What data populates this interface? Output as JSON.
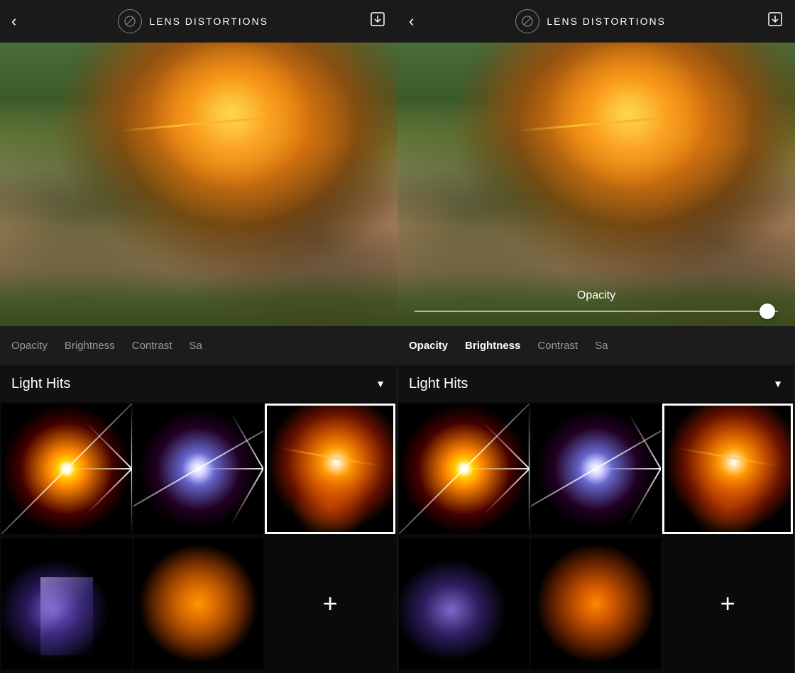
{
  "panels": [
    {
      "id": "left",
      "header": {
        "back_label": "‹",
        "logo_icon": "lens-logo",
        "title": "LENS DISTORTIONS",
        "download_icon": "download"
      },
      "controls": [
        {
          "label": "Opacity",
          "active": false
        },
        {
          "label": "Brightness",
          "active": false
        },
        {
          "label": "Contrast",
          "active": false
        },
        {
          "label": "Sa",
          "active": false
        }
      ],
      "opacity_slider_visible": false,
      "light_hits": {
        "title": "Light Hits",
        "dropdown_icon": "▼"
      }
    },
    {
      "id": "right",
      "header": {
        "back_label": "‹",
        "logo_icon": "lens-logo",
        "title": "LENS DISTORTIONS",
        "download_icon": "download"
      },
      "controls": [
        {
          "label": "Opacity",
          "active": true
        },
        {
          "label": "Brightness",
          "active": true
        },
        {
          "label": "Contrast",
          "active": false
        },
        {
          "label": "Sa",
          "active": false
        }
      ],
      "opacity_slider_visible": true,
      "opacity_label": "Opacity",
      "light_hits": {
        "title": "Light Hits",
        "dropdown_icon": "▼"
      }
    }
  ],
  "effects": [
    {
      "id": 1,
      "type": "flare-1",
      "selected": false
    },
    {
      "id": 2,
      "type": "flare-2",
      "selected": false
    },
    {
      "id": 3,
      "type": "flare-3",
      "selected": true
    },
    {
      "id": 4,
      "type": "flare-4",
      "selected": false
    },
    {
      "id": 5,
      "type": "flare-5",
      "selected": false
    },
    {
      "id": 6,
      "type": "add",
      "selected": false
    }
  ],
  "download_unicode": "⬇",
  "back_unicode": "‹"
}
